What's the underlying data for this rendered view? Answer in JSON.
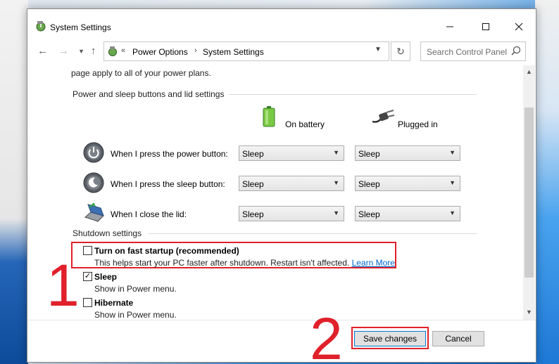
{
  "window": {
    "title": "System Settings"
  },
  "navigation": {
    "breadcrumb_sep": "«",
    "breadcrumb": [
      "Power Options",
      "System Settings"
    ],
    "crumb_sep": "›",
    "search_placeholder": "Search Control Panel"
  },
  "content": {
    "intro_text": "page apply to all of your power plans.",
    "power_section": {
      "heading": "Power and sleep buttons and lid settings",
      "col_battery": "On battery",
      "col_plugged": "Plugged in",
      "rows": [
        {
          "label": "When I press the power button:",
          "battery": "Sleep",
          "plugged": "Sleep"
        },
        {
          "label": "When I press the sleep button:",
          "battery": "Sleep",
          "plugged": "Sleep"
        },
        {
          "label": "When I close the lid:",
          "battery": "Sleep",
          "plugged": "Sleep"
        }
      ]
    },
    "shutdown_section": {
      "heading": "Shutdown settings",
      "options": [
        {
          "label": "Turn on fast startup (recommended)",
          "desc": "This helps start your PC faster after shutdown. Restart isn't affected.",
          "link": "Learn More",
          "checked": false
        },
        {
          "label": "Sleep",
          "desc": "Show in Power menu.",
          "checked": true
        },
        {
          "label": "Hibernate",
          "desc": "Show in Power menu.",
          "checked": false
        }
      ]
    }
  },
  "footer": {
    "save_label": "Save changes",
    "cancel_label": "Cancel"
  },
  "annotations": {
    "step1": "1",
    "step2": "2",
    "color": "#e0202a"
  },
  "colors": {
    "link": "#0066cc",
    "accent": "#0078d7"
  }
}
